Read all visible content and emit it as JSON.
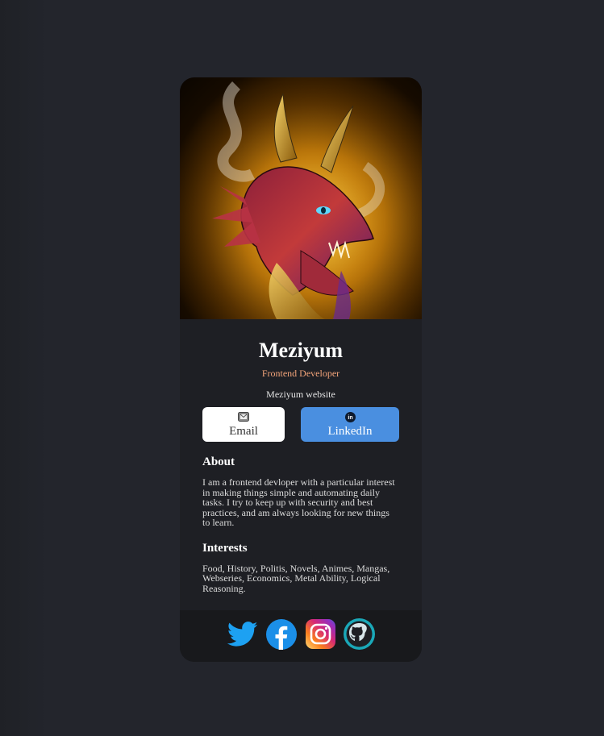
{
  "profile": {
    "name": "Meziyum",
    "role": "Frontend Developer",
    "website": "Meziyum website"
  },
  "buttons": {
    "email_label": "Email",
    "linkedin_label": "LinkedIn"
  },
  "about": {
    "heading": "About",
    "text": "I am a frontend devloper with a particular interest in making things simple and automating daily tasks. I try to keep up with security and best practices, and am always looking for new things to learn."
  },
  "interests": {
    "heading": "Interests",
    "text": "Food, History, Politis, Novels, Animes, Mangas, Webseries, Economics, Metal Ability, Logical Reasoning."
  },
  "social": [
    {
      "icon": "twitter-icon"
    },
    {
      "icon": "facebook-icon"
    },
    {
      "icon": "instagram-icon"
    },
    {
      "icon": "github-icon"
    }
  ],
  "colors": {
    "page_bg": "#23252c",
    "card_bg": "#1e1f24",
    "role_accent": "#f3a47a",
    "linkedin_button": "#4a8fe0",
    "email_button": "#ffffff"
  }
}
